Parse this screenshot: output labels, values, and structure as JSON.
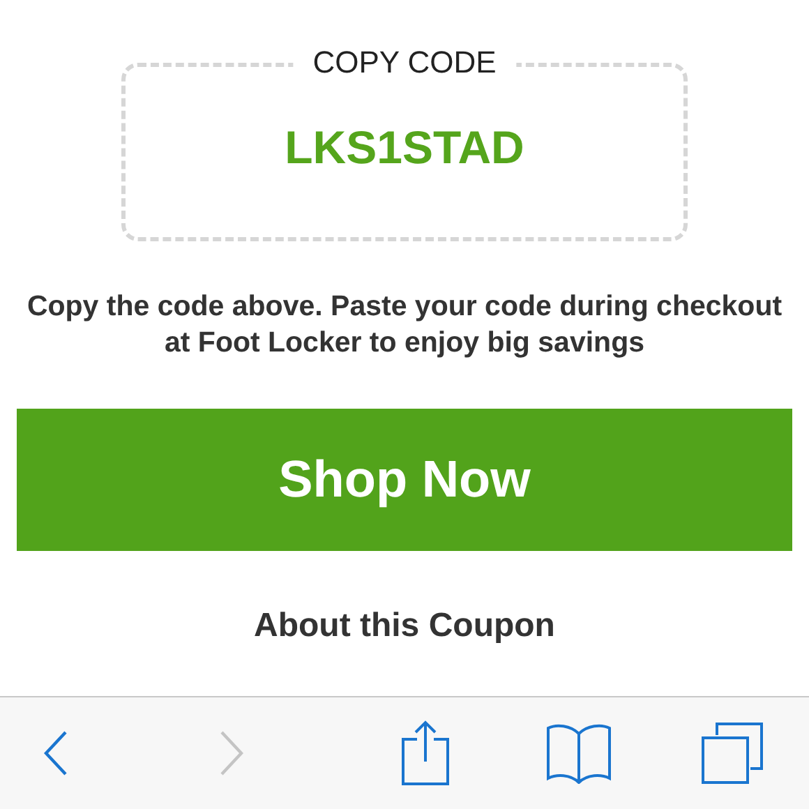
{
  "coupon": {
    "label": "COPY CODE",
    "code": "LKS1STAD"
  },
  "instructions": "Copy the code above. Paste your code during checkout at Foot Locker to enjoy big savings",
  "shop_button": "Shop Now",
  "about_heading": "About this Coupon",
  "toolbar": [
    {
      "kind": "back",
      "disabled": false
    },
    {
      "kind": "forward",
      "disabled": true
    },
    {
      "kind": "share",
      "disabled": false
    },
    {
      "kind": "bookmarks",
      "disabled": false
    },
    {
      "kind": "tabs",
      "disabled": false
    }
  ]
}
